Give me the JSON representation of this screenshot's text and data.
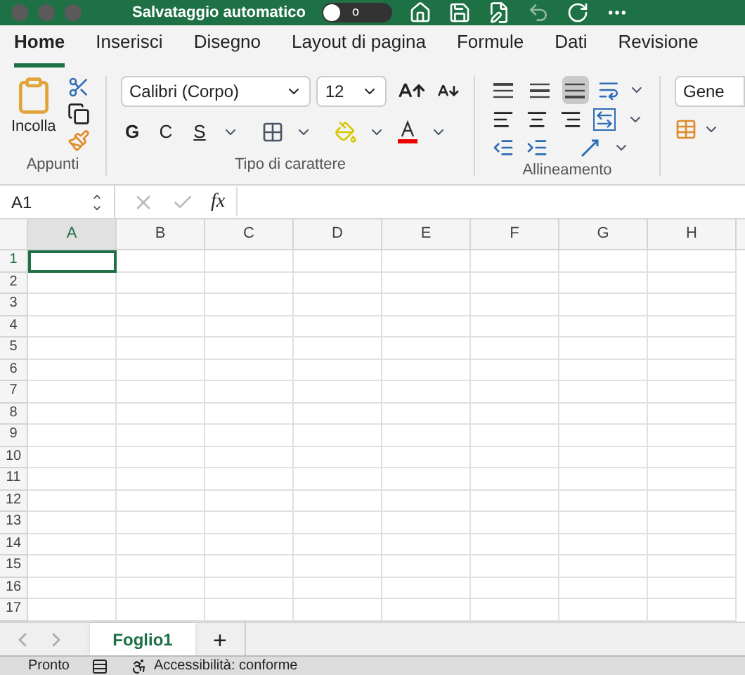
{
  "title_bar": {
    "autosave_label": "Salvataggio automatico",
    "autosave_on": false,
    "toggle_text": "o"
  },
  "tabs": [
    {
      "label": "Home",
      "selected": true
    },
    {
      "label": "Inserisci",
      "selected": false
    },
    {
      "label": "Disegno",
      "selected": false
    },
    {
      "label": "Layout di pagina",
      "selected": false
    },
    {
      "label": "Formule",
      "selected": false
    },
    {
      "label": "Dati",
      "selected": false
    },
    {
      "label": "Revisione",
      "selected": false
    }
  ],
  "ribbon": {
    "clipboard": {
      "paste_label": "Incolla",
      "group_label": "Appunti"
    },
    "font": {
      "font_name": "Calibri (Corpo)",
      "font_size": "12",
      "bold": "G",
      "italic": "C",
      "underline": "S",
      "group_label": "Tipo di carattere"
    },
    "alignment": {
      "vertical": [
        {
          "kind": "top",
          "selected": false
        },
        {
          "kind": "middle",
          "selected": false
        },
        {
          "kind": "bottom",
          "selected": true
        }
      ],
      "group_label": "Allineamento"
    },
    "number": {
      "format": "Gene"
    }
  },
  "formula_bar": {
    "name_box": "A1",
    "fx": "fx"
  },
  "grid": {
    "columns": [
      {
        "label": "A",
        "selected": true
      },
      {
        "label": "B",
        "selected": false
      },
      {
        "label": "C",
        "selected": false
      },
      {
        "label": "D",
        "selected": false
      },
      {
        "label": "E",
        "selected": false
      },
      {
        "label": "F",
        "selected": false
      },
      {
        "label": "G",
        "selected": false
      },
      {
        "label": "H",
        "selected": false
      }
    ],
    "rows": [
      {
        "label": "1",
        "selected": true
      },
      {
        "label": "2",
        "selected": false
      },
      {
        "label": "3",
        "selected": false
      },
      {
        "label": "4",
        "selected": false
      },
      {
        "label": "5",
        "selected": false
      },
      {
        "label": "6",
        "selected": false
      },
      {
        "label": "7",
        "selected": false
      },
      {
        "label": "8",
        "selected": false
      },
      {
        "label": "9",
        "selected": false
      },
      {
        "label": "10",
        "selected": false
      },
      {
        "label": "11",
        "selected": false
      },
      {
        "label": "12",
        "selected": false
      },
      {
        "label": "13",
        "selected": false
      },
      {
        "label": "14",
        "selected": false
      },
      {
        "label": "15",
        "selected": false
      },
      {
        "label": "16",
        "selected": false
      },
      {
        "label": "17",
        "selected": false
      }
    ]
  },
  "sheet_tabs": [
    {
      "label": "Foglio1",
      "selected": true
    }
  ],
  "add_sheet": "+",
  "status_bar": {
    "status": "Pronto",
    "accessibility": "Accessibilità: conforme"
  }
}
